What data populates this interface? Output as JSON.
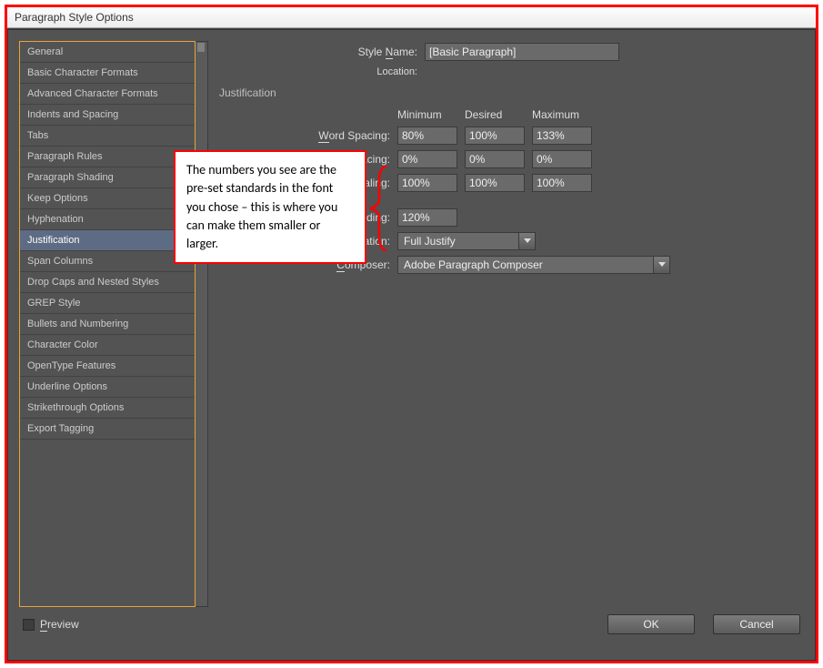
{
  "window": {
    "title": "Paragraph Style Options"
  },
  "sidebar": {
    "items": [
      {
        "label": "General"
      },
      {
        "label": "Basic Character Formats"
      },
      {
        "label": "Advanced Character Formats"
      },
      {
        "label": "Indents and Spacing"
      },
      {
        "label": "Tabs"
      },
      {
        "label": "Paragraph Rules"
      },
      {
        "label": "Paragraph Shading"
      },
      {
        "label": "Keep Options"
      },
      {
        "label": "Hyphenation"
      },
      {
        "label": "Justification",
        "selected": true
      },
      {
        "label": "Span Columns"
      },
      {
        "label": "Drop Caps and Nested Styles"
      },
      {
        "label": "GREP Style"
      },
      {
        "label": "Bullets and Numbering"
      },
      {
        "label": "Character Color"
      },
      {
        "label": "OpenType Features"
      },
      {
        "label": "Underline Options"
      },
      {
        "label": "Strikethrough Options"
      },
      {
        "label": "Export Tagging"
      }
    ]
  },
  "form": {
    "styleNameLabel": "Style Name:",
    "styleName": "[Basic Paragraph]",
    "locationLabel": "Location:",
    "sectionTitle": "Justification",
    "columns": {
      "min": "Minimum",
      "desired": "Desired",
      "max": "Maximum"
    },
    "rows": {
      "wordSpacing": {
        "label": "Word Spacing:",
        "min": "80%",
        "desired": "100%",
        "max": "133%"
      },
      "letterSpacing": {
        "label": "Letter Spacing:",
        "min": "0%",
        "desired": "0%",
        "max": "0%"
      },
      "glyphScaling": {
        "label": "Glyph Scaling:",
        "min": "100%",
        "desired": "100%",
        "max": "100%"
      }
    },
    "autoLeading": {
      "label": "Auto Leading:",
      "value": "120%"
    },
    "singleWord": {
      "label": "Single Word Justification:",
      "value": "Full Justify"
    },
    "composer": {
      "label": "Composer:",
      "value": "Adobe Paragraph Composer"
    }
  },
  "footer": {
    "preview": "Preview",
    "ok": "OK",
    "cancel": "Cancel"
  },
  "annotation": "The numbers you see are the pre-set standards in the font you chose – this is where you can make them smaller or larger."
}
